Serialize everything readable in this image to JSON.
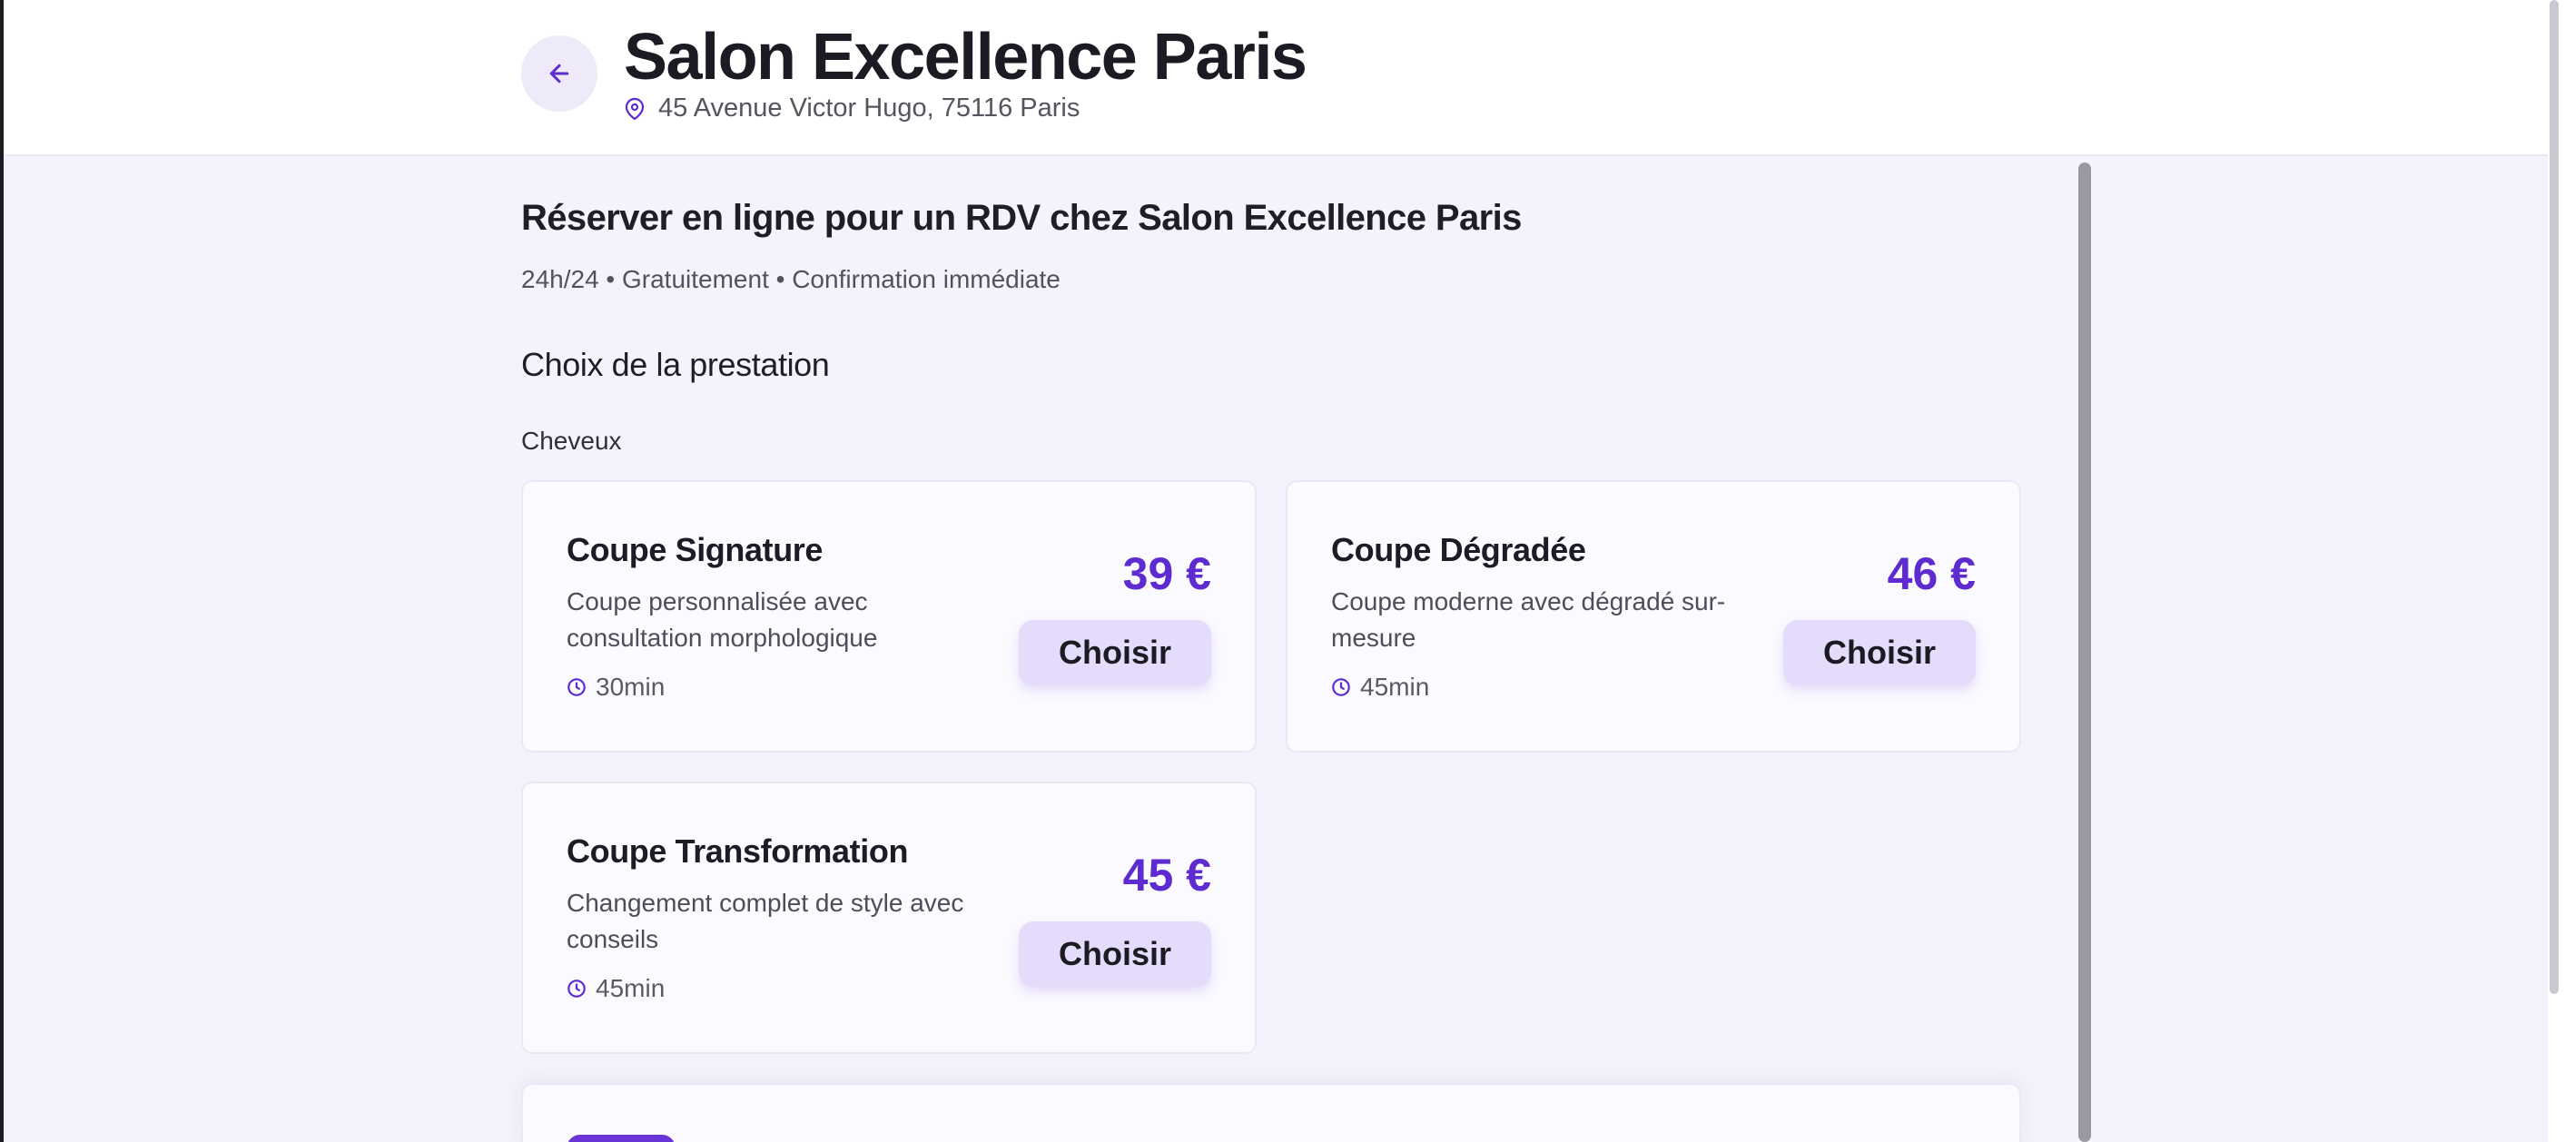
{
  "header": {
    "back_icon": "arrow-left-icon",
    "title": "Salon Excellence Paris",
    "address_icon": "map-pin-icon",
    "address": "45 Avenue Victor Hugo, 75116 Paris"
  },
  "booking": {
    "title": "Réserver en ligne pour un RDV chez Salon Excellence Paris",
    "meta": "24h/24 • Gratuitement • Confirmation immédiate"
  },
  "services": {
    "section_title": "Choix de la prestation",
    "category": "Cheveux",
    "items": [
      {
        "name": "Coupe Signature",
        "description": "Coupe personnalisée avec consultation morphologique",
        "duration": "30min",
        "price": "39 €",
        "button_label": "Choisir"
      },
      {
        "name": "Coupe Dégradée",
        "description": "Coupe moderne avec dégradé sur-mesure",
        "duration": "45min",
        "price": "46 €",
        "button_label": "Choisir"
      },
      {
        "name": "Coupe Transformation",
        "description": "Changement complet de style avec conseils",
        "duration": "45min",
        "price": "45 €",
        "button_label": "Choisir"
      }
    ]
  },
  "colors": {
    "accent": "#5d2bcf",
    "button_bg": "#e4dcfa",
    "page_bg": "#f5f2fd"
  }
}
